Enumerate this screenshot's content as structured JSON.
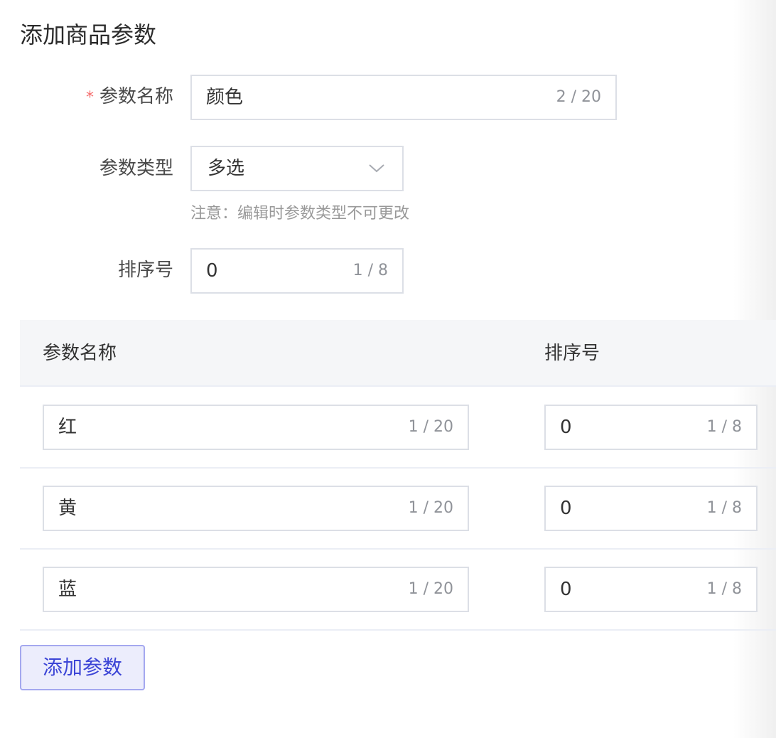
{
  "page": {
    "title": "添加商品参数"
  },
  "form": {
    "name_field": {
      "required_mark": "*",
      "label": "参数名称",
      "value": "颜色",
      "count": "2 / 20"
    },
    "type_field": {
      "label": "参数类型",
      "selected": "多选",
      "icon": "chevron-down-icon",
      "hint": "注意：编辑时参数类型不可更改"
    },
    "sort_field": {
      "label": "排序号",
      "value": "0",
      "count": "1 / 8"
    }
  },
  "table": {
    "columns": [
      "参数名称",
      "排序号"
    ],
    "rows": [
      {
        "name": "红",
        "name_count": "1 / 20",
        "sort": "0",
        "sort_count": "1 / 8"
      },
      {
        "name": "黄",
        "name_count": "1 / 20",
        "sort": "0",
        "sort_count": "1 / 8"
      },
      {
        "name": "蓝",
        "name_count": "1 / 20",
        "sort": "0",
        "sort_count": "1 / 8"
      }
    ]
  },
  "actions": {
    "add_label": "添加参数"
  },
  "colors": {
    "accent": "#3c45d6",
    "accent_bg": "#ecedfc",
    "required": "#f56c6c",
    "border": "#dcdfe6"
  }
}
